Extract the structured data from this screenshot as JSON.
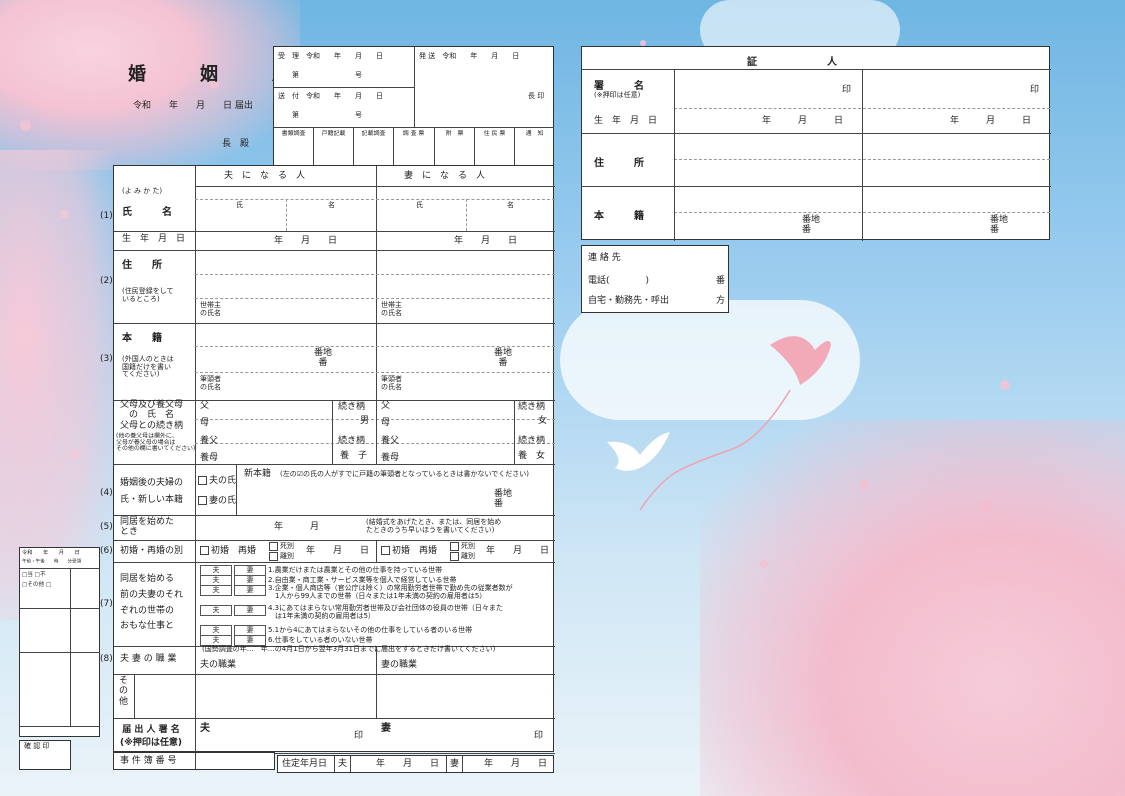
{
  "colors": {
    "sky_top": "#6fb6e3",
    "blossom": "#f4c3d3",
    "form_bg": "#ffffff",
    "line": "#333333",
    "bird": "#f2a9b8"
  },
  "header": {
    "title": "婚　姻　届",
    "date_line": "令和　　年　　月　　日 届出",
    "addressee": "長　殿"
  },
  "receipt": {
    "receive": "受　理　令和　　年　　月　　日",
    "receive_no": "第　　　　　　　　号",
    "send": "送　付　令和　　年　　月　　日",
    "send_no": "第　　　　　　　　号",
    "dispatch": "発 送　令和　　年　　月　　日",
    "chief_seal": "長 印",
    "checks": [
      "書類調査",
      "戸籍記載",
      "記載調査",
      "調 査 票",
      "附　票",
      "住 民 票",
      "通　知"
    ]
  },
  "form": {
    "husband_header": "夫　に　な　る　人",
    "wife_header": "妻　に　な　る　人",
    "yomi": "(よ み か た)",
    "row_nums": [
      "(1)",
      "(2)",
      "(3)",
      "(4)",
      "(5)",
      "(6)",
      "(7)",
      "(8)"
    ],
    "name_label": "氏　　　名",
    "family_name": "氏",
    "given_name": "名",
    "birth_label": "生　年　月　日",
    "ymd": "年　　月　　日",
    "address_label": "住　　所",
    "address_note": "(住民登録をして\nいるところ)",
    "householder": "世帯主\nの氏名",
    "honseki_label": "本　　籍",
    "honseki_note": "(外国人のときは\n国籍だけを書い\nてください)",
    "banchi": "番地\n番",
    "hittosha": "筆頭者\nの氏名",
    "parents_label": "父母及び養父母\nの　氏　名\n父母との続き柄",
    "parents_note": "(他の養父母は欄外に、\n父母が養父母の場合は\nその他の欄に書いてください)",
    "father": "父",
    "mother": "母",
    "ad_father": "養父",
    "ad_mother": "養母",
    "relation": "続き柄",
    "h_rel": "男",
    "w_rel": "女",
    "adoptive_rel": "養　子",
    "adoptive_rel_w": "養　女",
    "surname_label": "婚姻後の夫婦の\n氏・新しい本籍",
    "opt_husband": "夫の氏",
    "opt_wife": "妻の氏",
    "new_honseki": "新本籍",
    "new_honseki_note": "(左の☑の氏の人がすでに戸籍の筆頭者となっているときは書かないでください)",
    "cohab_label": "同居を始めた\nとき",
    "cohab_ym": "年　　　月",
    "cohab_note": "(結婚式をあげたとき、または、同居を始め\nたときのうち早いほうを書いてください)",
    "marriage_kind_label": "初婚・再婚の別",
    "first": "初婚",
    "remarriage": "再婚",
    "death": "死別",
    "divorce": "離別",
    "work_label": "同居を始める\n前の夫妻のそれ\nぞれの世帯の\nおもな仕事と",
    "occ_h": "夫",
    "occ_w": "妻",
    "work_items": [
      "1.農業だけまたは農業とその他の仕事を持っている世帯",
      "2.自由業・商工業・サービス業等を個人で経営している世帯",
      "3.企業・個人商店等（官公庁は除く）の常用勤労者世帯で勤め先の従業者数が\n　1人から99人までの世帯（日々または1年未満の契約の雇用者は5）",
      "4.3にあてはまらない常用勤労者世帯及び会社団体の役員の世帯（日々また\n　は1年未満の契約の雇用者は5）",
      "5.1から4にあてはまらないその他の仕事をしている者のいる世帯",
      "6.仕事をしている者のいない世帯"
    ],
    "census_note": "(国勢調査の年…　年…の4月1日から翌年3月31日までに届出をするときだけ書いてください)",
    "job_label": "夫 妻 の 職 業",
    "h_job": "夫の職業",
    "w_job": "妻の職業",
    "other_label": "そ\nの\n他",
    "sign_label": "届 出 人 署 名\n(※押印は任意)",
    "sign_h": "夫",
    "sign_w": "妻",
    "seal": "印",
    "case_no": "事 件 簿 番 号",
    "residence_date": "住定年月日",
    "res_h": "夫",
    "res_w": "妻",
    "res_ymd": "年　　月　　日"
  },
  "witness": {
    "title": "証　　　　　　　人",
    "sign": "署　　　名",
    "sign_note": "(※押印は任意)",
    "seal": "印",
    "birth": "生　年　月　日",
    "ymd": "年　　　月　　　日",
    "address": "住　　　所",
    "honseki": "本　　　籍",
    "banchi": "番地\n番"
  },
  "contact": {
    "label": "連 絡 先",
    "phone": "電話(　　　　)",
    "ban": "番",
    "place": "自宅・勤務先・呼出",
    "kata": "方"
  },
  "side_slip": {
    "head": "令和　　年　　月　　日",
    "sub": "午前・午後　　時　　分受領",
    "rows": [
      "□当 □不",
      "□その他 □",
      ""
    ],
    "confirm": "確 認 印"
  }
}
